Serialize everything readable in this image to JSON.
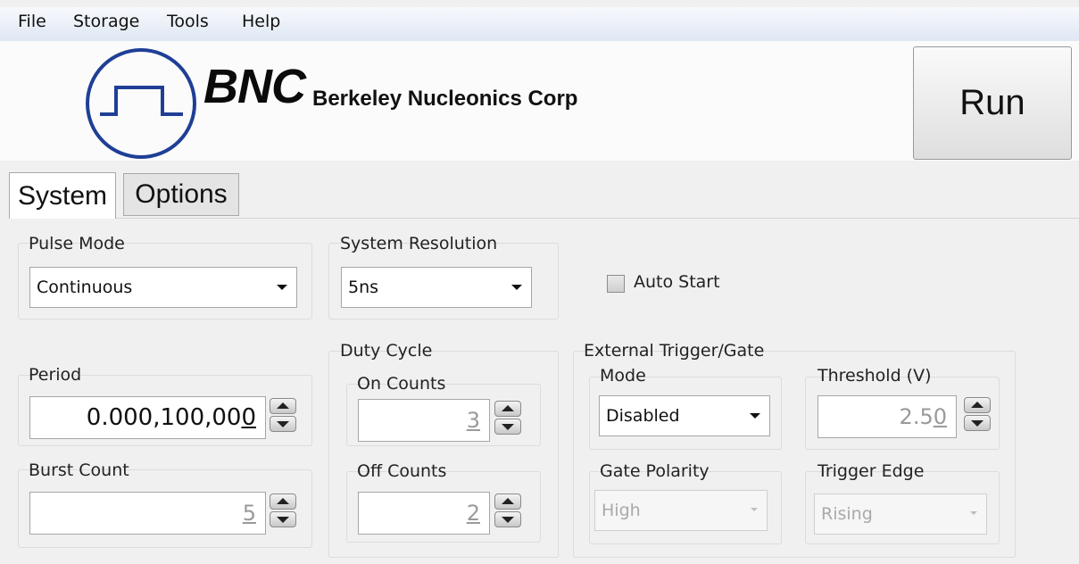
{
  "menu": [
    "File",
    "Storage",
    "Tools",
    "Help"
  ],
  "logo": {
    "brand": "BNC",
    "company": "Berkeley Nucleonics Corp"
  },
  "run_label": "Run",
  "tabs": [
    "System",
    "Options"
  ],
  "pulse_mode": {
    "label": "Pulse Mode",
    "value": "Continuous"
  },
  "system_resolution": {
    "label": "System Resolution",
    "value": "5ns"
  },
  "auto_start": {
    "label": "Auto Start",
    "checked": false
  },
  "period": {
    "label": "Period",
    "value_main": "0.000,100,00",
    "value_last": "0"
  },
  "burst_count": {
    "label": "Burst Count",
    "value": "5"
  },
  "duty_cycle": {
    "label": "Duty Cycle",
    "on_counts": {
      "label": "On Counts",
      "value": "3"
    },
    "off_counts": {
      "label": "Off Counts",
      "value": "2"
    }
  },
  "external_trigger": {
    "label": "External Trigger/Gate",
    "mode": {
      "label": "Mode",
      "value": "Disabled"
    },
    "threshold": {
      "label": "Threshold (V)",
      "value_main": "2.5",
      "value_last": "0"
    },
    "gate_polarity": {
      "label": "Gate Polarity",
      "value": "High"
    },
    "trigger_edge": {
      "label": "Trigger Edge",
      "value": "Rising"
    }
  },
  "colors": {
    "logo_blue": "#1f3f96",
    "background": "#f0f0f0"
  }
}
